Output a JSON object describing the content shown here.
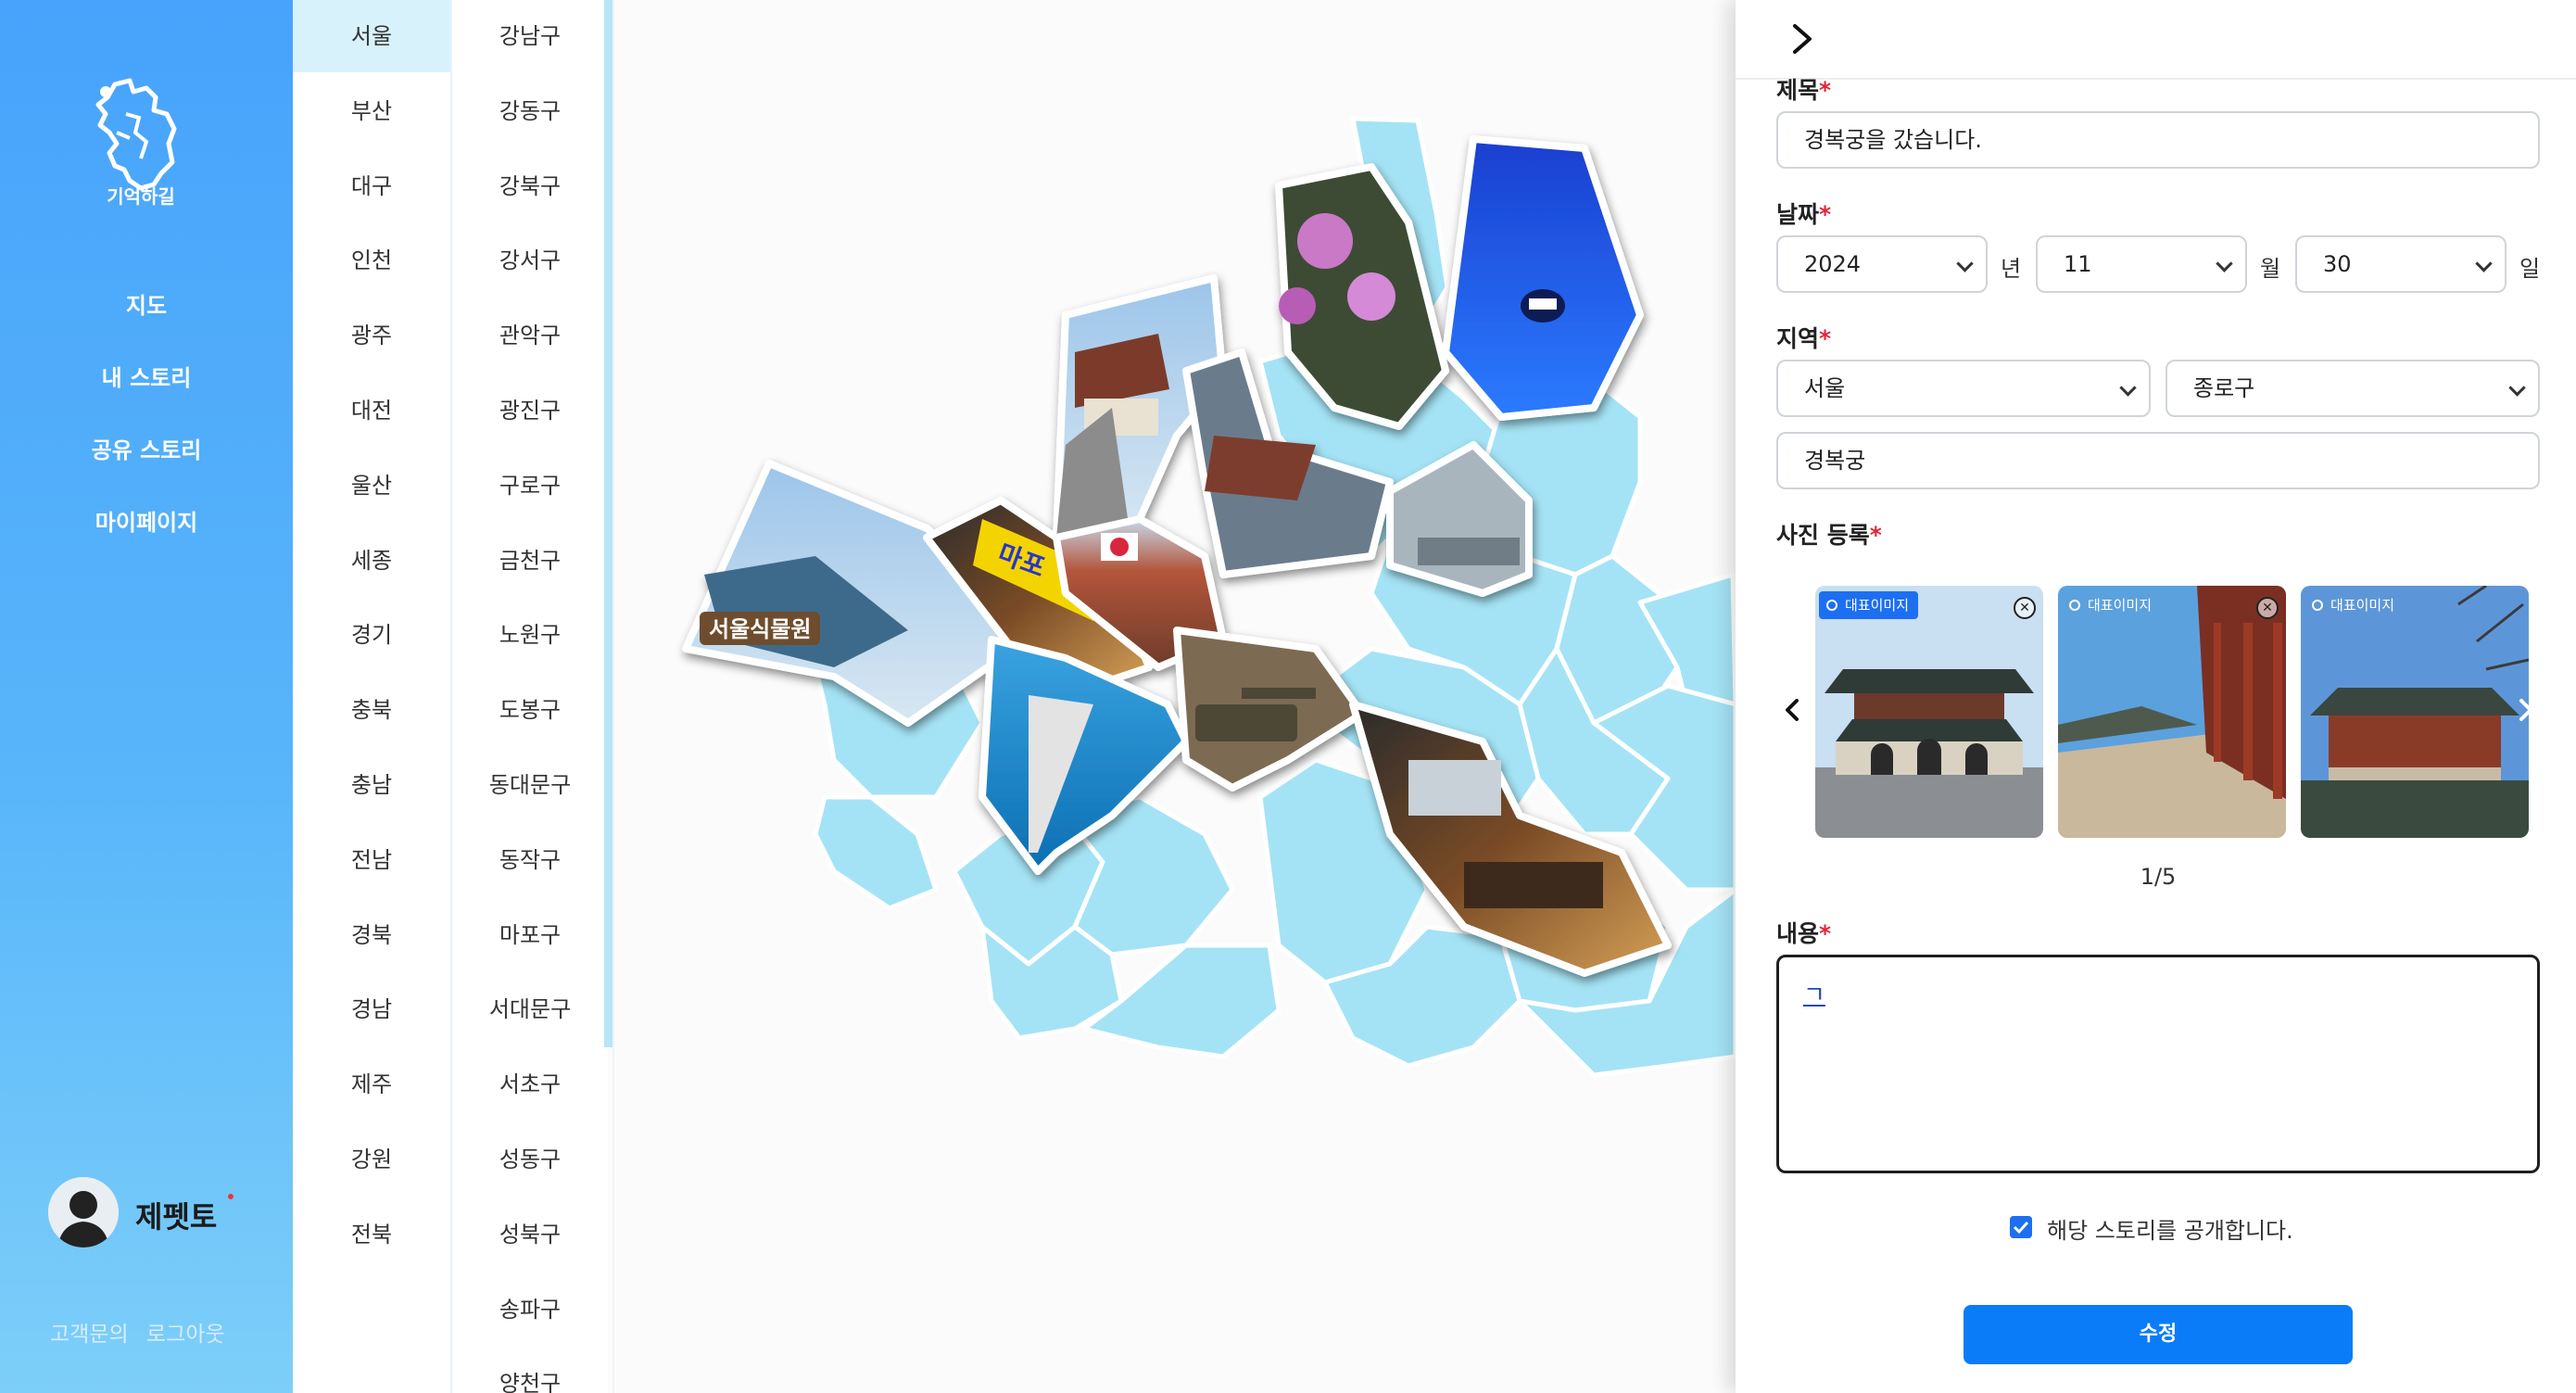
{
  "app": {
    "logo_text": "기억하길"
  },
  "nav": [
    {
      "label": "지도"
    },
    {
      "label": "내 스토리"
    },
    {
      "label": "공유 스토리"
    },
    {
      "label": "마이페이지"
    }
  ],
  "user": {
    "name": "제펫토"
  },
  "footer": {
    "support": "고객문의",
    "logout": "로그아웃"
  },
  "regions": [
    "서울",
    "부산",
    "대구",
    "인천",
    "광주",
    "대전",
    "울산",
    "세종",
    "경기",
    "충북",
    "충남",
    "전남",
    "경북",
    "경남",
    "제주",
    "강원",
    "전북"
  ],
  "active_region": "서울",
  "districts": [
    "강남구",
    "강동구",
    "강북구",
    "강서구",
    "관악구",
    "광진구",
    "구로구",
    "금천구",
    "노원구",
    "도봉구",
    "동대문구",
    "동작구",
    "마포구",
    "서대문구",
    "서초구",
    "성동구",
    "성북구",
    "송파구",
    "양천구"
  ],
  "map": {
    "region_color": "#a4e3f5",
    "photo_labels": [
      "서울식물원",
      "마포"
    ]
  },
  "form": {
    "title_label": "제목",
    "title_value": "경복궁을 갔습니다.",
    "date_label": "날짜",
    "year": "2024",
    "year_unit": "년",
    "month": "11",
    "month_unit": "월",
    "day": "30",
    "day_unit": "일",
    "area_label": "지역",
    "area_region": "서울",
    "area_district": "종로구",
    "place": "경복궁",
    "photo_label": "사진 등록",
    "thumb_badge": "대표이미지",
    "page_counter": "1/5",
    "content_label": "내용",
    "content_value": "ㄱ",
    "public_label": "해당 스토리를 공개합니다.",
    "public_checked": true,
    "submit_label": "수정",
    "required_mark": "*"
  },
  "colors": {
    "accent": "#0a7cf8",
    "sidebar_top": "#47a3fb",
    "required": "#e0263a"
  }
}
